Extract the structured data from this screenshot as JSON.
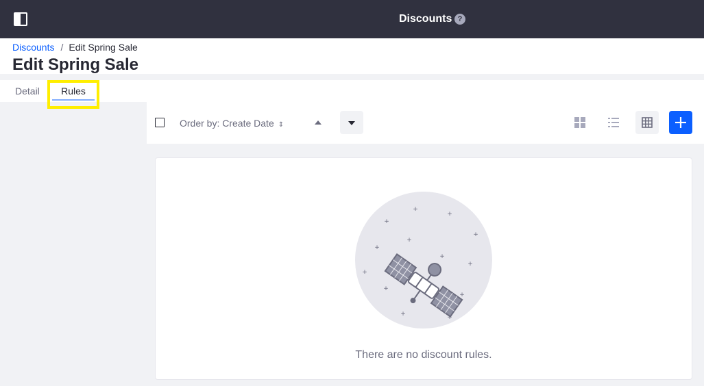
{
  "topbar": {
    "title": "Discounts",
    "help_glyph": "?",
    "icons": {
      "toggle": "sidebar-toggle-icon",
      "help": "help-icon"
    }
  },
  "breadcrumb": {
    "parent": "Discounts",
    "separator": "/",
    "current": "Edit Spring Sale"
  },
  "page": {
    "title": "Edit Spring Sale"
  },
  "tabs": [
    {
      "label": "Detail",
      "active": false
    },
    {
      "label": "Rules",
      "active": true
    }
  ],
  "toolbar": {
    "order_by_label": "Order by: Create Date",
    "icons": {
      "checkbox": "select-all-checkbox",
      "sort_asc": "caret-up-icon",
      "sort_desc": "caret-down-icon",
      "cards": "view-cards-icon",
      "list": "view-list-icon",
      "table": "view-table-icon",
      "add": "plus-icon"
    }
  },
  "empty_state": {
    "message": "There are no discount rules.",
    "illustration": "satellite-illustration"
  },
  "colors": {
    "topbar_bg": "#30313f",
    "accent": "#0b5fff",
    "highlight": "#ffee00",
    "page_bg": "#f1f2f5"
  }
}
